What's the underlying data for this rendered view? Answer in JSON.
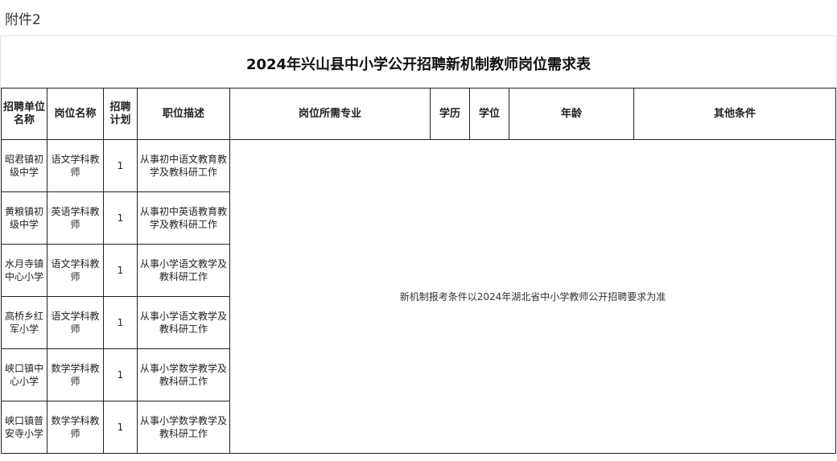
{
  "attachment_label": "附件2",
  "title": "2024年兴山县中小学公开招聘新机制教师岗位需求表",
  "headers": {
    "unit": "招聘单位名称",
    "position": "岗位名称",
    "plan": "招聘计划",
    "desc": "职位描述",
    "major": "岗位所需专业",
    "edu": "学历",
    "degree": "学位",
    "age": "年龄",
    "other": "其他条件"
  },
  "merged_note": "新机制报考条件以2024年湖北省中小学教师公开招聘要求为准",
  "rows": [
    {
      "unit": "昭君镇初级中学",
      "position": "语文学科教师",
      "plan": "1",
      "desc": "从事初中语文教育教学及教科研工作"
    },
    {
      "unit": "黄粮镇初级中学",
      "position": "英语学科教师",
      "plan": "1",
      "desc": "从事初中英语教育教学及教科研工作"
    },
    {
      "unit": "水月寺镇中心小学",
      "position": "语文学科教师",
      "plan": "1",
      "desc": "从事小学语文教学及教科研工作"
    },
    {
      "unit": "高桥乡红军小学",
      "position": "语文学科教师",
      "plan": "1",
      "desc": "从事小学语文教学及教科研工作"
    },
    {
      "unit": "峡口镇中心小学",
      "position": "数学学科教师",
      "plan": "1",
      "desc": "从事小学数学教学及教科研工作"
    },
    {
      "unit": "峡口镇普安寺小学",
      "position": "数学学科教师",
      "plan": "1",
      "desc": "从事小学数学教学及教科研工作"
    }
  ]
}
